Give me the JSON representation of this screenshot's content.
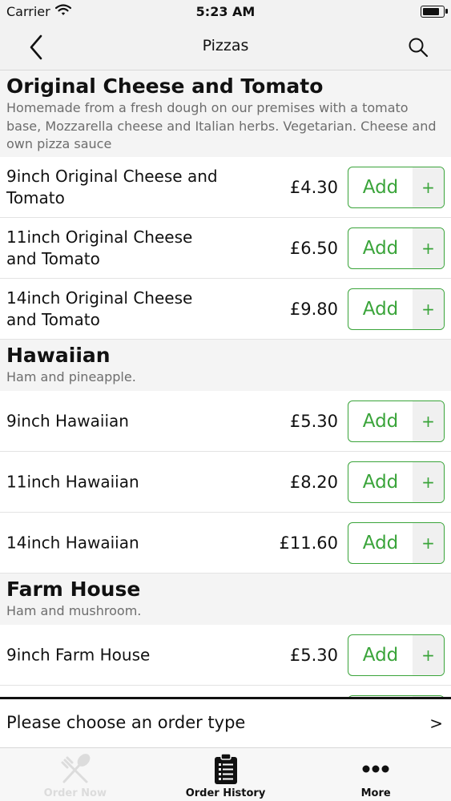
{
  "status_bar": {
    "carrier": "Carrier",
    "time": "5:23 AM",
    "battery_level": 0.9
  },
  "nav": {
    "title": "Pizzas"
  },
  "menu": {
    "categories": [
      {
        "title": "Original Cheese and Tomato",
        "description": "Homemade from a fresh dough on our premises with a tomato base, Mozzarella cheese and Italian herbs. Vegetarian. Cheese and own pizza sauce",
        "items": [
          {
            "name": "9inch Original Cheese and Tomato",
            "price": "£4.30",
            "add_label": "Add",
            "plus": "+"
          },
          {
            "name": "11inch Original Cheese and Tomato",
            "price": "£6.50",
            "add_label": "Add",
            "plus": "+"
          },
          {
            "name": "14inch Original Cheese and Tomato",
            "price": "£9.80",
            "add_label": "Add",
            "plus": "+"
          }
        ]
      },
      {
        "title": "Hawaiian",
        "description": "Ham and pineapple.",
        "items": [
          {
            "name": "9inch Hawaiian",
            "price": "£5.30",
            "add_label": "Add",
            "plus": "+"
          },
          {
            "name": "11inch Hawaiian",
            "price": "£8.20",
            "add_label": "Add",
            "plus": "+"
          },
          {
            "name": "14inch Hawaiian",
            "price": "£11.60",
            "add_label": "Add",
            "plus": "+"
          }
        ]
      },
      {
        "title": "Farm House",
        "description": "Ham and mushroom.",
        "items": [
          {
            "name": "9inch Farm House",
            "price": "£5.30",
            "add_label": "Add",
            "plus": "+"
          },
          {
            "name": "",
            "price": "",
            "add_label": "",
            "plus": ""
          }
        ]
      }
    ]
  },
  "order_type": {
    "label": "Please choose an order type",
    "chevron": ">"
  },
  "tabs": [
    {
      "label": "Order Now",
      "icon": "fork-spoon-icon",
      "active": true
    },
    {
      "label": "Order History",
      "icon": "clipboard-list-icon",
      "active": false
    },
    {
      "label": "More",
      "icon": "more-dots-icon",
      "active": false
    }
  ],
  "colors": {
    "accent": "#3aa43a",
    "header_bg": "#f2f2f2",
    "category_bg": "#f4f4f4"
  }
}
